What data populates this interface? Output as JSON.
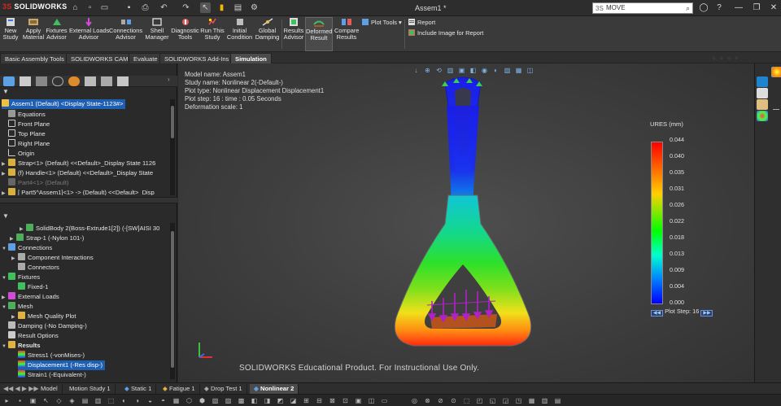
{
  "titlebar": {
    "logo_prefix": "3S",
    "logo_text": "SOLIDWORKS",
    "doc_title": "Assem1 *",
    "search_value": "MOVE"
  },
  "commands": [
    {
      "label": "New\nStudy",
      "icon": "new-study-icon"
    },
    {
      "label": "Apply\nMaterial",
      "icon": "apply-material-icon"
    },
    {
      "label": "Fixtures\nAdvisor",
      "icon": "fixtures-advisor-icon"
    },
    {
      "label": "External Loads\nAdvisor",
      "icon": "external-loads-icon"
    },
    {
      "label": "Connections\nAdvisor",
      "icon": "connections-advisor-icon"
    },
    {
      "label": "Shell\nManager",
      "icon": "shell-manager-icon"
    },
    {
      "label": "Diagnostic\nTools",
      "icon": "diagnostic-tools-icon"
    },
    {
      "label": "Run This\nStudy",
      "icon": "run-study-icon"
    },
    {
      "label": "Initial\nCondition",
      "icon": "initial-condition-icon"
    },
    {
      "label": "Global\nDamping",
      "icon": "global-damping-icon"
    },
    {
      "label": "Results\nAdvisor",
      "icon": "results-advisor-icon"
    },
    {
      "label": "Deformed\nResult",
      "icon": "deformed-result-icon"
    },
    {
      "label": "Compare\nResults",
      "icon": "compare-results-icon"
    }
  ],
  "small_commands": {
    "plot_tools": "Plot Tools",
    "report": "Report",
    "include_image": "Include Image for Report"
  },
  "cmd_tabs": [
    "Basic Assembly Tools",
    "SOLIDWORKS CAM",
    "Evaluate",
    "SOLIDWORKS Add-Ins",
    "Simulation"
  ],
  "feature_tree": [
    {
      "label": "Assem1 (Default) <Display State-1123#>",
      "selected": true
    },
    {
      "label": "Equations"
    },
    {
      "label": "Front Plane"
    },
    {
      "label": "Top Plane"
    },
    {
      "label": "Right Plane"
    },
    {
      "label": "Origin"
    },
    {
      "label": "Strap<1> (Default) <<Default>_Display State 1126"
    },
    {
      "label": "(f) Handle<1> (Default) <<Default>_Display State"
    },
    {
      "label": "Part4<1> (Default)",
      "dim": true
    },
    {
      "label": "[ Part5^Assem1]<1> -> (Default) <<Default>_Disp"
    }
  ],
  "sim_tree": [
    {
      "label": "SolidBody 2(Boss-Extrude1[2]) (-[SW]AISI 30"
    },
    {
      "label": "Strap-1 (-Nylon 101-)"
    },
    {
      "label": "Connections"
    },
    {
      "label": "Component Interactions"
    },
    {
      "label": "Connectors"
    },
    {
      "label": "Fixtures"
    },
    {
      "label": "Fixed-1"
    },
    {
      "label": "External Loads"
    },
    {
      "label": "Mesh"
    },
    {
      "label": "Mesh Quality Plot"
    },
    {
      "label": "Damping (-No Damping-)"
    },
    {
      "label": "Result Options"
    },
    {
      "label": "Results"
    },
    {
      "label": "Stress1 (-vonMises-)"
    },
    {
      "label": "Displacement1 (-Res disp-)",
      "selected": true
    },
    {
      "label": "Strain1 (-Equivalent-)"
    }
  ],
  "plot_info": [
    "Model name: Assem1",
    "Study name: Nonlinear 2(-Default-)",
    "Plot type: Nonlinear Displacement Displacement1",
    "Plot step: 16 :  time : 0.05 Seconds",
    "Deformation scale: 1"
  ],
  "legend": {
    "title": "URES (mm)",
    "values": [
      "0.044",
      "0.040",
      "0.035",
      "0.031",
      "0.026",
      "0.022",
      "0.018",
      "0.013",
      "0.009",
      "0.004",
      "0.000"
    ],
    "plot_step_label": "Plot Step: 16"
  },
  "watermark": "SOLIDWORKS Educational Product. For Instructional Use Only.",
  "bottom_tabs": [
    "Model",
    "Motion Study 1",
    "Static 1",
    "Fatigue 1",
    "Drop Test 1",
    "Nonlinear 2"
  ],
  "colors": {
    "accent": "#1f5fb2",
    "bg": "#2b2b2b",
    "legend_high": "#ff0000",
    "legend_low": "#0000ff"
  }
}
